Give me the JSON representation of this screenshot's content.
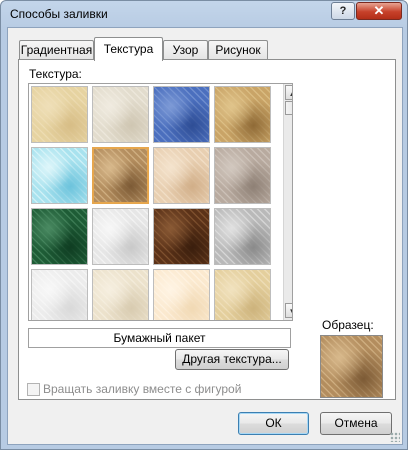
{
  "window": {
    "title": "Способы заливки",
    "help_label": "?",
    "close_label": "✕"
  },
  "tabs": [
    {
      "label": "Градиентная",
      "active": false
    },
    {
      "label": "Текстура",
      "active": true
    },
    {
      "label": "Узор",
      "active": false
    },
    {
      "label": "Рисунок",
      "active": false
    }
  ],
  "texture_tab": {
    "section_label": "Текстура:",
    "selected_texture": "Бумажный пакет",
    "other_texture_button": "Другая текстура...",
    "sample_label": "Образец:",
    "rotate_checkbox": {
      "label": "Вращать заливку вместе с фигурой",
      "checked": false,
      "enabled": false
    }
  },
  "textures": [
    {
      "name": "papyrus",
      "colors": [
        "#e6d3a1",
        "#d7bd86",
        "#efdfb8"
      ]
    },
    {
      "name": "canvas",
      "colors": [
        "#e2dccd",
        "#cfc6b2",
        "#f0ebe0"
      ]
    },
    {
      "name": "denim",
      "colors": [
        "#4b6fbe",
        "#2e4d95",
        "#7d9ad6"
      ]
    },
    {
      "name": "woven-mat",
      "colors": [
        "#c9a467",
        "#8f6a36",
        "#e0c48b"
      ]
    },
    {
      "name": "water-droplets",
      "colors": [
        "#a8e2ee",
        "#6cc3dc",
        "#def6fa"
      ]
    },
    {
      "name": "paper-bag",
      "colors": [
        "#b38d5e",
        "#7c5a35",
        "#d8b98c"
      ]
    },
    {
      "name": "fish-fossil",
      "colors": [
        "#e8cfb1",
        "#d1ae88",
        "#f4e3cd"
      ]
    },
    {
      "name": "sand",
      "colors": [
        "#b8aa9f",
        "#8e8075",
        "#d2c8bf"
      ]
    },
    {
      "name": "green-marble",
      "colors": [
        "#1e5c36",
        "#0f3d22",
        "#4a8a62"
      ]
    },
    {
      "name": "white-marble",
      "colors": [
        "#e6e6e6",
        "#c9c9c9",
        "#f7f7f7"
      ]
    },
    {
      "name": "brown-marble",
      "colors": [
        "#5b3218",
        "#3a1e0d",
        "#8a5a35"
      ]
    },
    {
      "name": "granite",
      "colors": [
        "#b9b9b9",
        "#8a8a8a",
        "#e1e1e1"
      ]
    },
    {
      "name": "recycled-paper",
      "colors": [
        "#ececec",
        "#d9d9d9",
        "#f8f8f8"
      ]
    },
    {
      "name": "stationery",
      "colors": [
        "#ece2cc",
        "#d8cbb0",
        "#f6efe0"
      ]
    },
    {
      "name": "parchment",
      "colors": [
        "#fbe9cf",
        "#f1d9b4",
        "#fff4e4"
      ]
    },
    {
      "name": "cork",
      "colors": [
        "#e4cf9d",
        "#cdb37c",
        "#f1e2bf"
      ]
    }
  ],
  "selected_index": 5,
  "buttons": {
    "ok": "ОК",
    "cancel": "Отмена"
  }
}
